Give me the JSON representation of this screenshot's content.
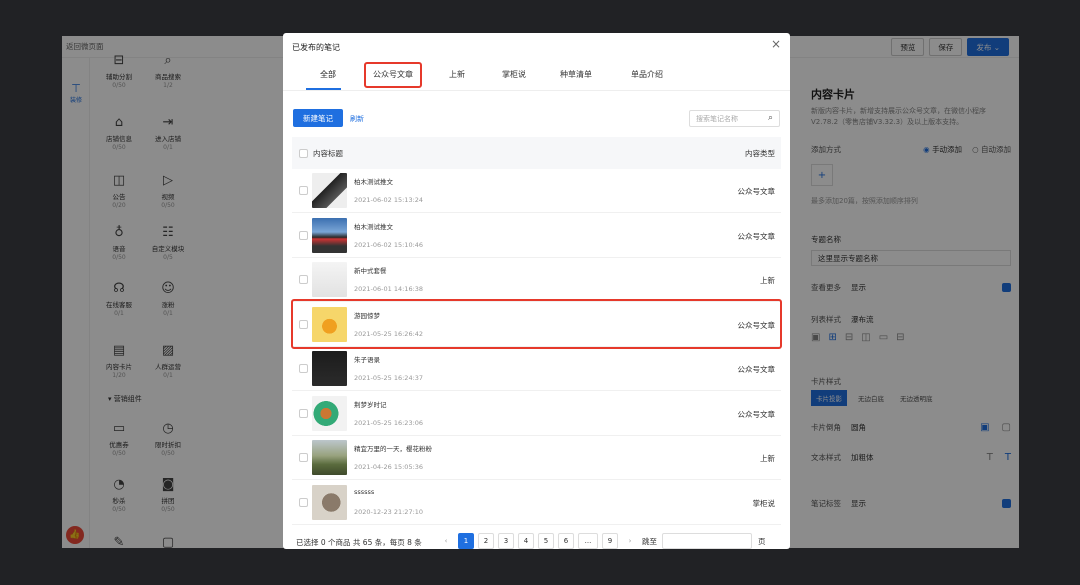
{
  "topbar": {
    "back_label": "返回微页面",
    "preview": "预览",
    "save": "保存",
    "publish": "发布"
  },
  "rail": {
    "active_label": "装修"
  },
  "palette": {
    "items": [
      {
        "name": "辅助分割",
        "count": "0/50"
      },
      {
        "name": "商品搜索",
        "count": "1/2"
      },
      {
        "name": "店铺信息",
        "count": "0/50"
      },
      {
        "name": "进入店铺",
        "count": "0/1"
      },
      {
        "name": "公告",
        "count": "0/20"
      },
      {
        "name": "视频",
        "count": "0/50"
      },
      {
        "name": "语音",
        "count": "0/50"
      },
      {
        "name": "自定义模块",
        "count": "0/5"
      },
      {
        "name": "在线客服",
        "count": "0/1"
      },
      {
        "name": "涨粉",
        "count": "0/1"
      },
      {
        "name": "内容卡片",
        "count": "1/20"
      },
      {
        "name": "人群运营",
        "count": "0/1"
      },
      {
        "name": "优惠券",
        "count": "0/50"
      },
      {
        "name": "限时折扣",
        "count": "0/50"
      },
      {
        "name": "秒杀",
        "count": "0/50"
      },
      {
        "name": "拼团",
        "count": "0/50"
      },
      {
        "name": "砍价",
        "count": ""
      },
      {
        "name": "定金膨胀",
        "count": ""
      }
    ],
    "marketing_section": "营销组件"
  },
  "right_panel": {
    "title": "内容卡片",
    "desc": "新版内容卡片，新增支持展示公众号文章，在微信小程序V2.78.2（零售店铺V3.32.3）及以上版本支持。",
    "add_method_label": "添加方式",
    "manual": "手动添加",
    "auto": "自动添加",
    "max_note": "最多添加20篇，按照添加顺序排列",
    "topic_label": "专题名称",
    "topic_value": "这里显示专题名称",
    "more_label": "查看更多",
    "more_value": "显示",
    "list_style_label": "列表样式",
    "list_style_value": "瀑布流",
    "card_style_label": "卡片样式",
    "card_styles": [
      "卡片投影",
      "无边白底",
      "无边透明底"
    ],
    "corner_label": "卡片倒角",
    "corner_value": "圆角",
    "text_style_label": "文本样式",
    "text_style_value": "加粗体",
    "note_tag_label": "笔记标签",
    "note_tag_value": "显示"
  },
  "modal": {
    "title": "已发布的笔记",
    "tabs": [
      "全部",
      "公众号文章",
      "上新",
      "掌柜说",
      "种草清单",
      "单品介绍"
    ],
    "new_button": "新建笔记",
    "refresh": "刷新",
    "search_placeholder": "搜索笔记名称",
    "col_title": "内容标题",
    "col_type": "内容类型",
    "rows": [
      {
        "title": "柏木测试推文",
        "date": "2021-06-02 15:13:24",
        "type": "公众号文章"
      },
      {
        "title": "柏木测试推文",
        "date": "2021-06-02 15:10:46",
        "type": "公众号文章"
      },
      {
        "title": "新中式套餐",
        "date": "2021-06-01 14:16:38",
        "type": "上新"
      },
      {
        "title": "游园惊梦",
        "date": "2021-05-25 16:26:42",
        "type": "公众号文章"
      },
      {
        "title": "朱子语录",
        "date": "2021-05-25 16:24:37",
        "type": "公众号文章"
      },
      {
        "title": "荆梦岁时记",
        "date": "2021-05-25 16:23:06",
        "type": "公众号文章"
      },
      {
        "title": "精宜万里的一天，樱花粉粉",
        "date": "2021-04-26 15:05:36",
        "type": "上新"
      },
      {
        "title": "ssssss",
        "date": "2020-12-23 21:27:10",
        "type": "掌柜说"
      }
    ],
    "footer": {
      "selected": "已选择 0 个商品 共 65 条，每页 8 条",
      "pages": [
        "1",
        "2",
        "3",
        "4",
        "5",
        "6",
        "...",
        "9"
      ],
      "goto": "跳至",
      "page_unit": "页"
    }
  },
  "colors": {
    "accent": "#1f6fe0",
    "highlight": "#e6392b"
  }
}
